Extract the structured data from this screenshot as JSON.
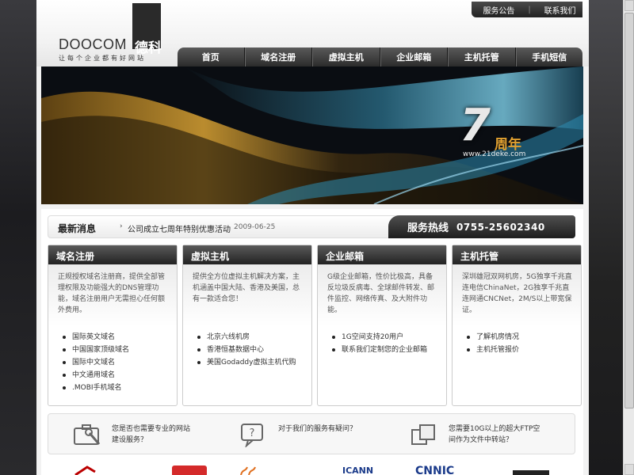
{
  "brand": {
    "name_en": "DOOCOM",
    "name_cn": "德科",
    "tagline": "让每个企业都有好网站"
  },
  "toplinks": {
    "announce": "服务公告",
    "separator": "|",
    "contact": "联系我们"
  },
  "nav": [
    {
      "label": "首页"
    },
    {
      "label": "域名注册"
    },
    {
      "label": "虚拟主机"
    },
    {
      "label": "企业邮箱"
    },
    {
      "label": "主机托管"
    },
    {
      "label": "手机短信"
    }
  ],
  "banner": {
    "number": "7",
    "years": "周年",
    "url": "www.21deke.com"
  },
  "news": {
    "title": "最新消息",
    "arrow": "›",
    "item": "公司成立七周年特别优惠活动",
    "date": "2009-06-25"
  },
  "hotline": {
    "label": "服务热线",
    "number": "0755-25602340"
  },
  "boxes": [
    {
      "title": "域名注册",
      "desc": "正规授权域名注册商，提供全部管理权限及功能强大的DNS管理功能，域名注册用户无需担心任何额外费用。",
      "items": [
        "国际英文域名",
        "中国国家顶级域名",
        "国际中文域名",
        "中文通用域名",
        ".MOBI手机域名"
      ]
    },
    {
      "title": "虚拟主机",
      "desc": "提供全方位虚拟主机解决方案，主机涵盖中国大陆、香港及美国，总有一款适合您！",
      "items": [
        "北京六线机房",
        "香港恒基数据中心",
        "美国Godaddy虚拟主机代购"
      ]
    },
    {
      "title": "企业邮箱",
      "desc": "G级企业邮箱，性价比极高，具备反垃圾反病毒、全球邮件转发、邮件监控、网络传真、及大附件功能。",
      "items": [
        "1G空间支持20用户",
        "联系我们定制您的企业邮箱"
      ]
    },
    {
      "title": "主机托管",
      "desc": "深圳雄冠双网机房，5G独享千兆直连电信ChinaNet，2G独享千兆直连网通CNCNet，2M/S以上带宽保证。",
      "items": [
        "了解机房情况",
        "主机托管报价"
      ]
    }
  ],
  "help": [
    {
      "icon": "toolbox-icon",
      "text1": "您是否也需要专业的网站",
      "text2": "建设服务？"
    },
    {
      "icon": "question-bubble-icon",
      "text1": "对于我们的服务有疑问？",
      "text2": ""
    },
    {
      "icon": "folders-icon",
      "text1": "您需要10G以上的超大FTP空",
      "text2": "间作为文件中转站？"
    }
  ],
  "partner_logos": {
    "l4": "ICANN",
    "l5": "CNNIC"
  }
}
